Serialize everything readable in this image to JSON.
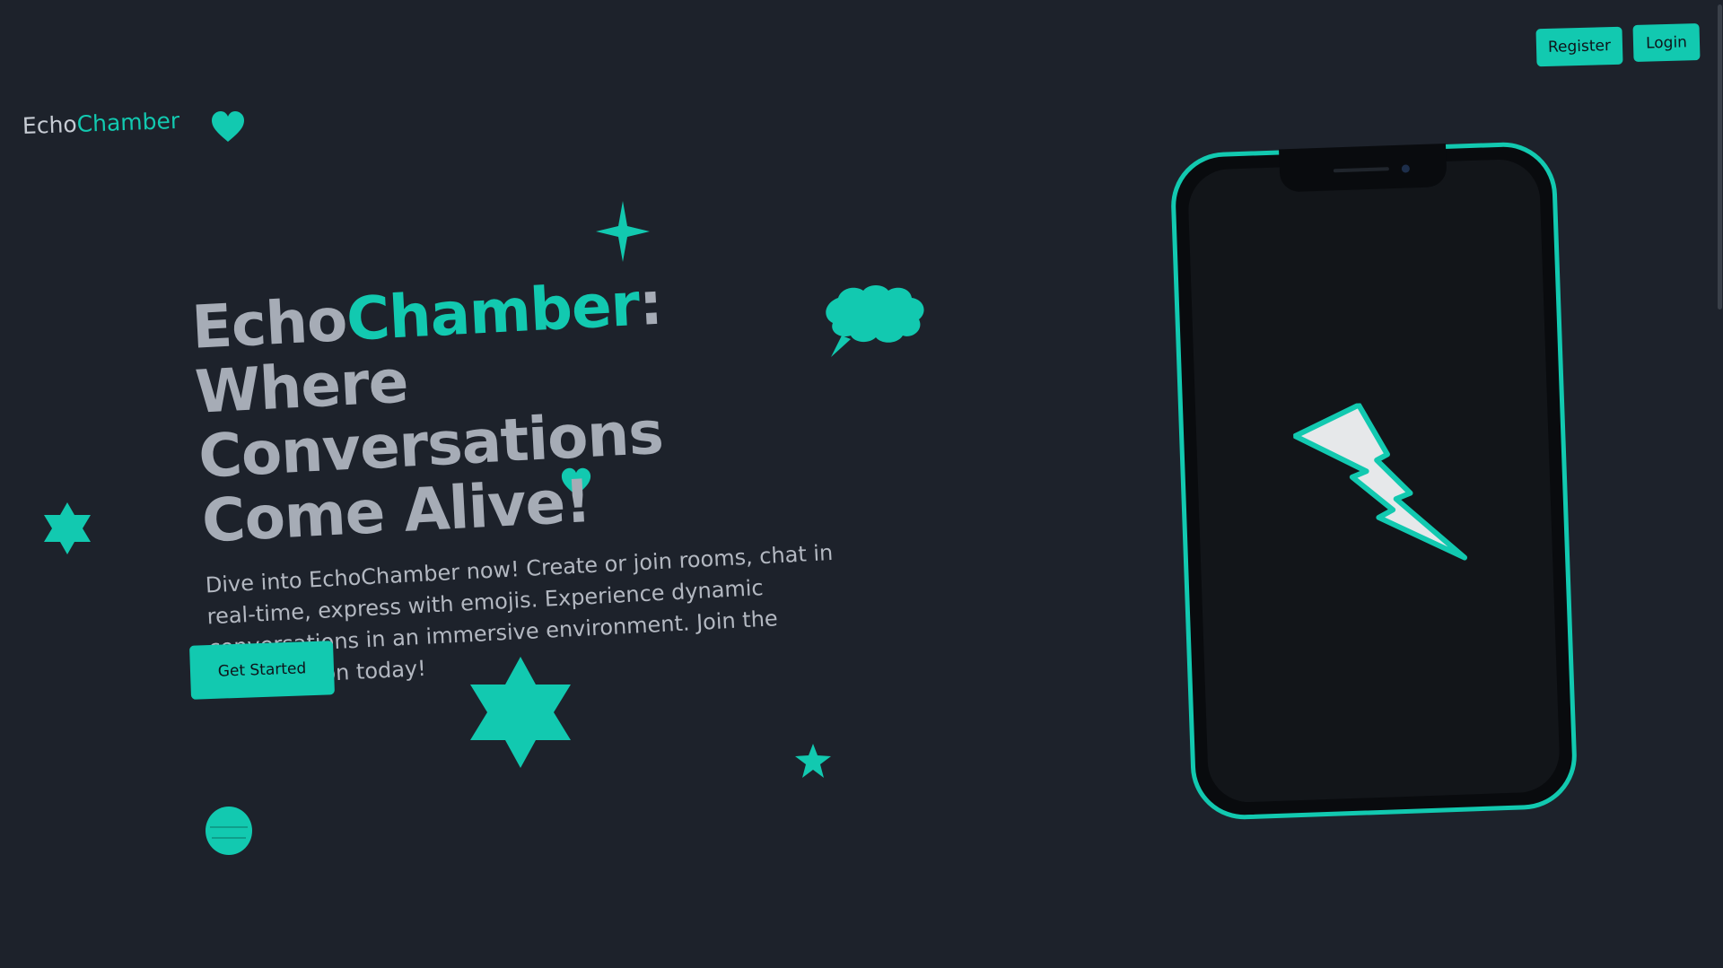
{
  "nav": {
    "register_label": "Register",
    "login_label": "Login"
  },
  "logo": {
    "part1": "Echo",
    "part2": "Chamber"
  },
  "hero": {
    "title_part1": "Echo",
    "title_part2": "Chamber",
    "title_colon": ":",
    "title_line2": "Where Conversations",
    "title_line3": "Come Alive!",
    "description": "Dive into EchoChamber now! Create or join rooms, chat in real-time, express with emojis. Experience dynamic conversations in an immersive environment. Join the conversation today!",
    "cta_label": "Get Started"
  },
  "colors": {
    "accent": "#12c9b0",
    "background": "#1d222b",
    "heading": "#a6acb6"
  },
  "icons": [
    "heart-icon",
    "sparkle-icon",
    "speech-bubble-icon",
    "star-of-david-icon",
    "star-icon",
    "globe-icon",
    "lightning-bolt-icon"
  ]
}
